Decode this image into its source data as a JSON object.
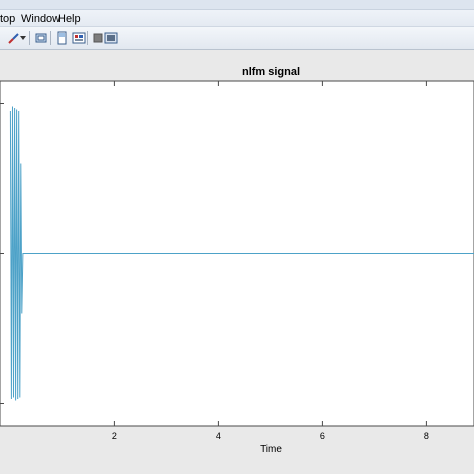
{
  "menu": {
    "items": [
      {
        "label": "top"
      },
      {
        "label": "Window"
      },
      {
        "label": "Help"
      }
    ]
  },
  "toolbar": {
    "icons": [
      "brush-icon",
      "dropdown-arrow-icon",
      "rotate-icon",
      "copy-figure-icon",
      "property-editor-icon",
      "hide-tools-icon",
      "show-tools-icon"
    ]
  },
  "chart_data": {
    "type": "line",
    "title": "nlfm signal",
    "xlabel": "Time",
    "ylabel": "",
    "x_ticks": [
      "2",
      "4",
      "6",
      "8"
    ],
    "xlim": [
      0.0,
      10.0
    ],
    "ylim": [
      -1.0,
      1.0
    ],
    "series": [
      {
        "color": "#4da2c8",
        "x": [
          0.0,
          0.02,
          0.04,
          0.06,
          0.08,
          0.1,
          0.12,
          0.14,
          0.16,
          0.18,
          0.2,
          0.22,
          0.24,
          0.26,
          0.28,
          0.3,
          0.32,
          0.34,
          0.36,
          0.38,
          1.0,
          10.0
        ],
        "y": [
          0.95,
          -0.97,
          0.98,
          -0.96,
          0.97,
          -0.98,
          0.96,
          -0.97,
          0.95,
          -0.96,
          0.6,
          -0.4,
          0.0,
          0.0,
          0.0,
          0.0,
          0.0,
          0.0,
          0.0,
          0.0,
          0.0,
          0.0
        ]
      }
    ]
  }
}
